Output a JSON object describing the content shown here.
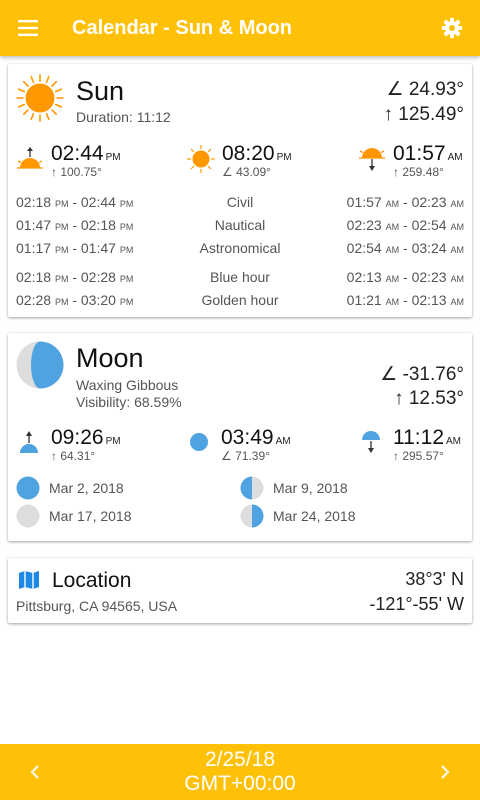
{
  "appbar": {
    "title": "Calendar - Sun & Moon"
  },
  "sun": {
    "title": "Sun",
    "duration": "Duration: 11:12",
    "elevation": "∠ 24.93°",
    "azimuth": "↑ 125.49°",
    "rise": {
      "time": "02:44",
      "ampm": "PM",
      "deg": "↑ 100.75°"
    },
    "noon": {
      "time": "08:20",
      "ampm": "PM",
      "deg": "∠ 43.09°"
    },
    "set": {
      "time": "01:57",
      "ampm": "AM",
      "deg": "↑ 259.48°"
    },
    "rows": [
      {
        "l1": "02:18",
        "la1": "PM",
        "l2": "02:44",
        "la2": "PM",
        "label": "Civil",
        "r1": "01:57",
        "ra1": "AM",
        "r2": "02:23",
        "ra2": "AM"
      },
      {
        "l1": "01:47",
        "la1": "PM",
        "l2": "02:18",
        "la2": "PM",
        "label": "Nautical",
        "r1": "02:23",
        "ra1": "AM",
        "r2": "02:54",
        "ra2": "AM"
      },
      {
        "l1": "01:17",
        "la1": "PM",
        "l2": "01:47",
        "la2": "PM",
        "label": "Astronomical",
        "r1": "02:54",
        "ra1": "AM",
        "r2": "03:24",
        "ra2": "AM"
      },
      {
        "l1": "02:18",
        "la1": "PM",
        "l2": "02:28",
        "la2": "PM",
        "label": "Blue hour",
        "r1": "02:13",
        "ra1": "AM",
        "r2": "02:23",
        "ra2": "AM"
      },
      {
        "l1": "02:28",
        "la1": "PM",
        "l2": "03:20",
        "la2": "PM",
        "label": "Golden hour",
        "r1": "01:21",
        "ra1": "AM",
        "r2": "02:13",
        "ra2": "AM"
      }
    ]
  },
  "moon": {
    "title": "Moon",
    "phase": "Waxing Gibbous",
    "visibility": "Visibility: 68.59%",
    "elevation": "∠ -31.76°",
    "azimuth": "↑ 12.53°",
    "rise": {
      "time": "09:26",
      "ampm": "PM",
      "deg": "↑ 64.31°"
    },
    "transit": {
      "time": "03:49",
      "ampm": "AM",
      "deg": "∠ 71.39°"
    },
    "set": {
      "time": "11:12",
      "ampm": "AM",
      "deg": "↑ 295.57°"
    },
    "phases": {
      "full": "Mar 2, 2018",
      "last_quarter": "Mar 9, 2018",
      "new": "Mar 17, 2018",
      "first_quarter": "Mar 24, 2018"
    }
  },
  "location": {
    "title": "Location",
    "address": "Pittsburg, CA 94565, USA",
    "lat": "38°3' N",
    "lon": "-121°-55' W"
  },
  "bottombar": {
    "date": "2/25/18",
    "tz": "GMT+00:00"
  },
  "colors": {
    "accent": "#FFC107",
    "sun": "#FF9800",
    "moon": "#4FA3E0",
    "moon_shadow": "#DDDDDD"
  },
  "icons": {
    "menu": "menu-icon",
    "settings": "gear-icon",
    "sun": "sun-icon",
    "sunrise": "sunrise-icon",
    "sunset": "sunset-icon",
    "moon": "moon-icon",
    "location": "map-icon",
    "prev": "chevron-left-icon",
    "next": "chevron-right-icon"
  }
}
